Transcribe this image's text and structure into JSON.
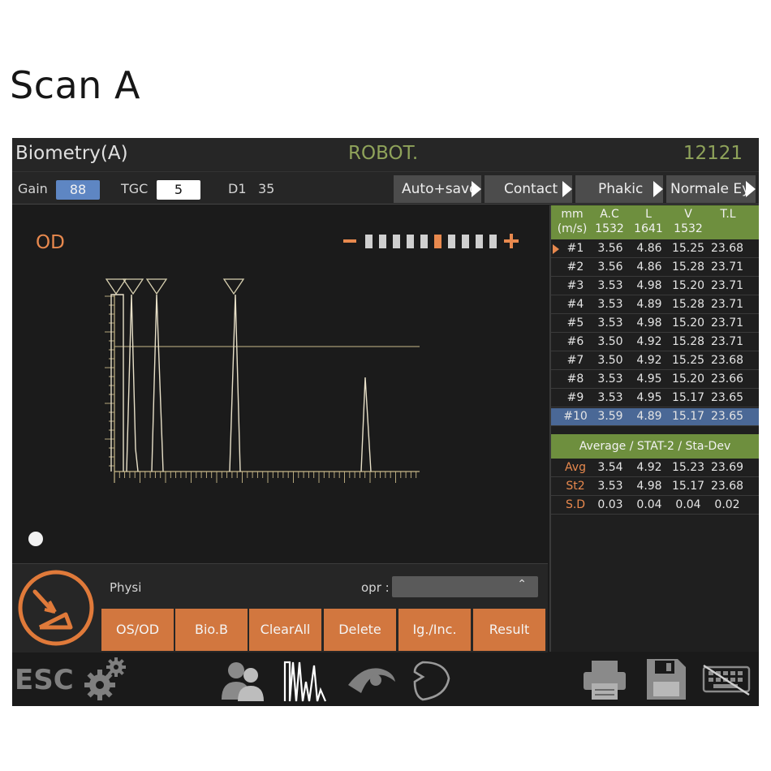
{
  "page_title": "Scan A",
  "header": {
    "title": "Biometry(A)",
    "center": "ROBOT.",
    "right": "12121"
  },
  "toolbar": {
    "gain_label": "Gain",
    "gain_value": "88",
    "tgc_label": "TGC",
    "tgc_value": "5",
    "d1_label": "D1",
    "d1_value": "35",
    "buttons": [
      "Auto+save",
      "Contact",
      "Phakic",
      "Normale Ey"
    ]
  },
  "scan": {
    "eye_label": "OD"
  },
  "table": {
    "header_row1": [
      "mm",
      "A.C",
      "L",
      "V",
      "T.L"
    ],
    "header_row2": [
      "(m/s)",
      "1532",
      "1641",
      "1532",
      ""
    ],
    "rows": [
      [
        "#1",
        "3.56",
        "4.86",
        "15.25",
        "23.68"
      ],
      [
        "#2",
        "3.56",
        "4.86",
        "15.28",
        "23.71"
      ],
      [
        "#3",
        "3.53",
        "4.98",
        "15.20",
        "23.71"
      ],
      [
        "#4",
        "3.53",
        "4.89",
        "15.28",
        "23.71"
      ],
      [
        "#5",
        "3.53",
        "4.98",
        "15.20",
        "23.71"
      ],
      [
        "#6",
        "3.50",
        "4.92",
        "15.28",
        "23.71"
      ],
      [
        "#7",
        "3.50",
        "4.92",
        "15.25",
        "23.68"
      ],
      [
        "#8",
        "3.53",
        "4.95",
        "15.20",
        "23.66"
      ],
      [
        "#9",
        "3.53",
        "4.95",
        "15.17",
        "23.65"
      ],
      [
        "#10",
        "3.59",
        "4.89",
        "15.17",
        "23.65"
      ]
    ],
    "stat_title": "Average / STAT-2 / Sta-Dev",
    "stats": [
      [
        "Avg",
        "3.54",
        "4.92",
        "15.23",
        "23.69"
      ],
      [
        "St2",
        "3.53",
        "4.98",
        "15.17",
        "23.68"
      ],
      [
        "S.D",
        "0.03",
        "0.04",
        "0.04",
        "0.02"
      ]
    ]
  },
  "controls": {
    "physi_label": "Physi",
    "opr_label": "opr :",
    "opr_value": "",
    "actions": [
      "OS/OD",
      "Bio.B",
      "ClearAll",
      "Delete",
      "Ig./Inc.",
      "Result"
    ]
  },
  "footer": {
    "esc_label": "ESC"
  },
  "colors": {
    "accent": "#d2773f",
    "header_green": "#6e8f3e",
    "selected_row": "#4a6896",
    "title_green": "#8fa35a"
  }
}
